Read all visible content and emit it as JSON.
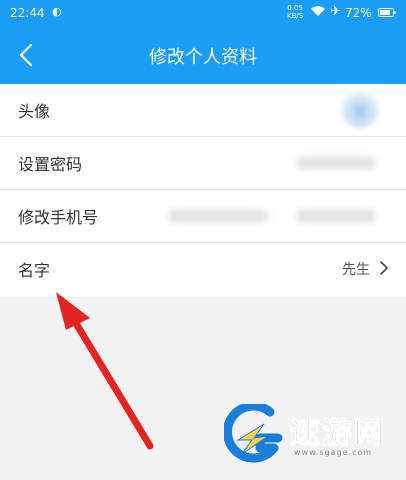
{
  "status_bar": {
    "time": "22:44",
    "sync_icon": "sync-icon",
    "speed_value": "0.05",
    "speed_unit": "KB/S",
    "battery": "72%"
  },
  "nav": {
    "title": "修改个人资料",
    "back_icon": "chevron-left-icon"
  },
  "rows": [
    {
      "label": "头像"
    },
    {
      "label": "设置密码"
    },
    {
      "label": "修改手机号"
    },
    {
      "label": "名字",
      "value": "先生"
    }
  ],
  "watermark": {
    "text": "速游网",
    "url": "www.sgage.com"
  },
  "colors": {
    "primary": "#1a9ef5",
    "arrow": "#e52421",
    "watermark": "#1a7fd8"
  }
}
